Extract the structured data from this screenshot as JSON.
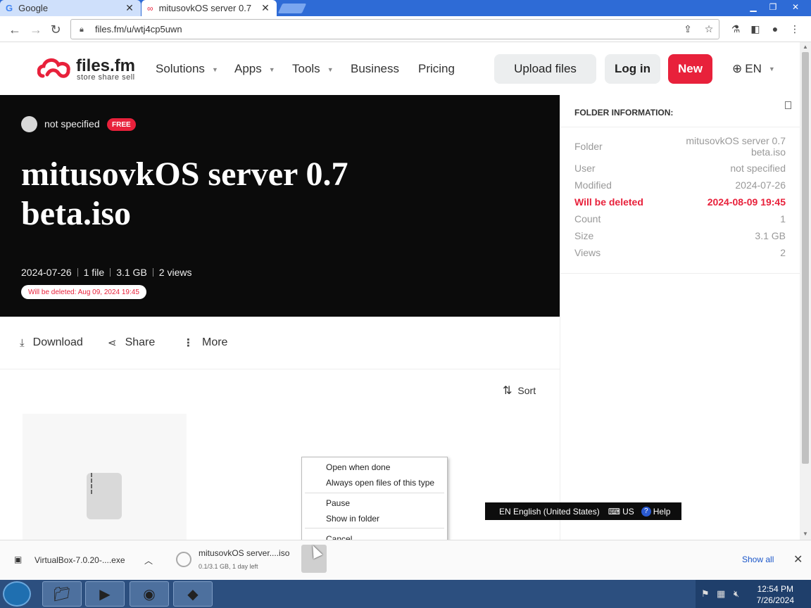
{
  "browser": {
    "tabs": [
      {
        "title": "Google",
        "icon": "google-icon"
      },
      {
        "title": "mitusovkOS server 0.7",
        "icon": "filesfm-icon"
      }
    ],
    "url": "files.fm/u/wtj4cp5uwn"
  },
  "header": {
    "logo_text": "files.fm",
    "logo_tagline": "store share sell",
    "nav": [
      "Solutions",
      "Apps",
      "Tools",
      "Business",
      "Pricing"
    ],
    "upload": "Upload files",
    "login": "Log in",
    "new": "New",
    "lang": "EN",
    "brand_color": "#e8213b"
  },
  "hero": {
    "owner": "not specified",
    "plan_badge": "FREE",
    "title": "mitusovkOS server 0.7 beta.iso",
    "date": "2024-07-26",
    "files": "1 file",
    "size": "3.1 GB",
    "views": "2 views",
    "delete_notice": "Will be deleted: Aug 09, 2024 19:45"
  },
  "actions": {
    "download": "Download",
    "share": "Share",
    "more": "More",
    "sort": "Sort"
  },
  "folder_info": {
    "heading": "FOLDER INFORMATION:",
    "rows": [
      {
        "label": "Folder",
        "value": "mitusovkOS server 0.7 beta.iso"
      },
      {
        "label": "User",
        "value": "not specified"
      },
      {
        "label": "Modified",
        "value": "2024-07-26"
      },
      {
        "label": "Will be deleted",
        "value": "2024-08-09 19:45"
      },
      {
        "label": "Count",
        "value": "1"
      },
      {
        "label": "Size",
        "value": "3.1 GB"
      },
      {
        "label": "Views",
        "value": "2"
      }
    ]
  },
  "context_menu": {
    "items": [
      "Open when done",
      "Always open files of this type",
      "Pause",
      "Show in folder",
      "Cancel"
    ]
  },
  "language_bar": {
    "lang": "EN English (United States)",
    "keyboard": "US",
    "help": "Help"
  },
  "downloads": {
    "items": [
      {
        "name": "VirtualBox-7.0.20-....exe"
      },
      {
        "name": "mitusovkOS server....iso",
        "status": "0.1/3.1 GB, 1 day left"
      }
    ],
    "show_all": "Show all"
  },
  "taskbar": {
    "time": "12:54 PM",
    "date": "7/26/2024"
  }
}
